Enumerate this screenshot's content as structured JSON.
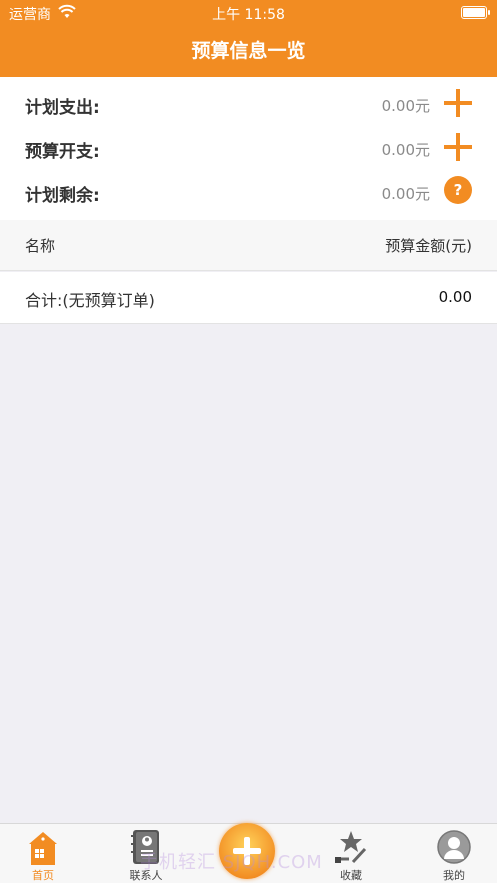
{
  "status_bar": {
    "carrier": "运营商",
    "time": "上午 11:58"
  },
  "nav": {
    "title": "预算信息一览"
  },
  "summary": {
    "rows": [
      {
        "label": "计划支出:",
        "value": "0.00元",
        "action_icon": "plus-icon"
      },
      {
        "label": "预算开支:",
        "value": "0.00元",
        "action_icon": "plus-icon"
      },
      {
        "label": "计划剩余:",
        "value": "0.00元",
        "action_icon": "help-icon",
        "action_text": "?"
      }
    ]
  },
  "table": {
    "headers": {
      "name": "名称",
      "amount": "预算金额(元)"
    },
    "rows": [
      {
        "name": "合计:(无预算订单)",
        "amount": "0.00"
      }
    ]
  },
  "tabbar": {
    "items": [
      {
        "label": "首页",
        "icon": "home-icon",
        "active": true
      },
      {
        "label": "联系人",
        "icon": "contacts-icon",
        "active": false
      },
      {
        "label": "",
        "icon": "add-icon",
        "active": false
      },
      {
        "label": "收藏",
        "icon": "star-icon",
        "active": false
      },
      {
        "label": "我的",
        "icon": "user-icon",
        "active": false
      }
    ]
  },
  "watermark": "手机轻汇 SJQH.COM",
  "colors": {
    "accent": "#f28c22",
    "background": "#f0eff4"
  }
}
